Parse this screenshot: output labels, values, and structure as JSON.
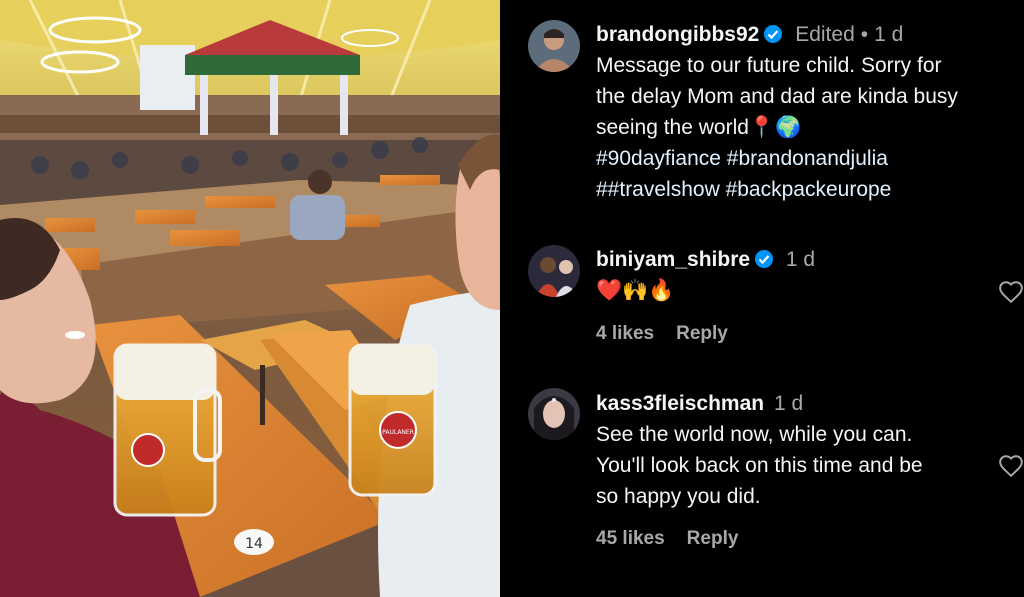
{
  "comments": [
    {
      "username": "brandongibbs92",
      "verified": true,
      "edited_label": "Edited",
      "time": "1 d",
      "lines": [
        "Message to our future child. Sorry for",
        "the delay Mom and dad are kinda busy",
        "seeing the world📍🌍"
      ],
      "hashtags_line1": "#90dayfiance #brandonandjulia",
      "hashtags_line2": "##travelshow #backpackeurope"
    },
    {
      "username": "biniyam_shibre",
      "verified": true,
      "time": "1 d",
      "text": "❤️🙌🔥",
      "likes": "4 likes",
      "reply": "Reply"
    },
    {
      "username": "kass3fleischman",
      "verified": false,
      "time": "1 d",
      "lines": [
        "See the world now, while you can.",
        "You'll look back on this time and be",
        "so happy you did."
      ],
      "likes": "45 likes",
      "reply": "Reply"
    }
  ],
  "photo": {
    "table_number": "14",
    "mug_brand": "PAULANER"
  },
  "colors": {
    "background": "#000000",
    "text": "#f5f5f5",
    "secondary": "#a8a8a8",
    "verified_blue": "#0095f6",
    "hashtag": "#e0f1ff"
  },
  "icons": [
    "verified-badge-icon",
    "heart-icon"
  ]
}
